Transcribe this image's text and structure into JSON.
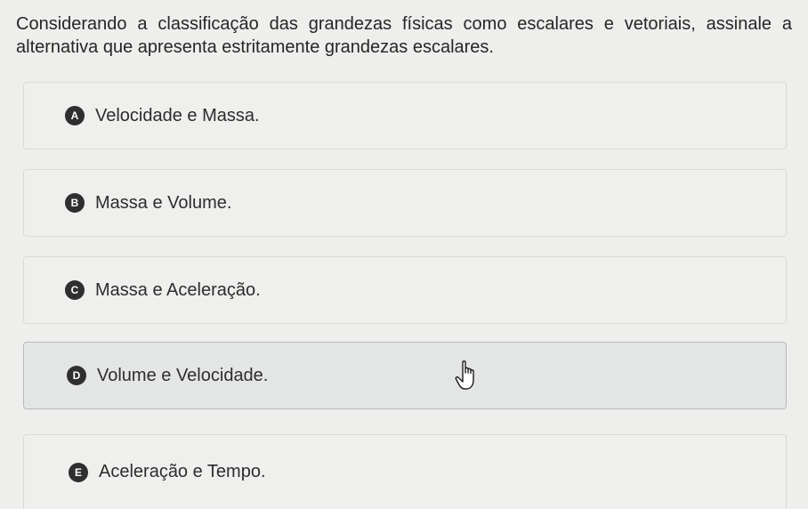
{
  "question": {
    "text": "Considerando a classificação das grandezas físicas como escalares e vetoriais, assinale a alternativa que apresenta estritamente grandezas escalares."
  },
  "options": [
    {
      "letter": "A",
      "text": "Velocidade e Massa."
    },
    {
      "letter": "B",
      "text": "Massa e Volume."
    },
    {
      "letter": "C",
      "text": "Massa e Aceleração."
    },
    {
      "letter": "D",
      "text": "Volume e Velocidade."
    },
    {
      "letter": "E",
      "text": "Aceleração e Tempo."
    }
  ],
  "hovered_option": "D",
  "cursor": {
    "icon": "hand-pointer-icon"
  },
  "colors": {
    "badge": "#2f2f2f",
    "card_border": "#d9d9d6",
    "hover_background": "#e4e6e5"
  }
}
